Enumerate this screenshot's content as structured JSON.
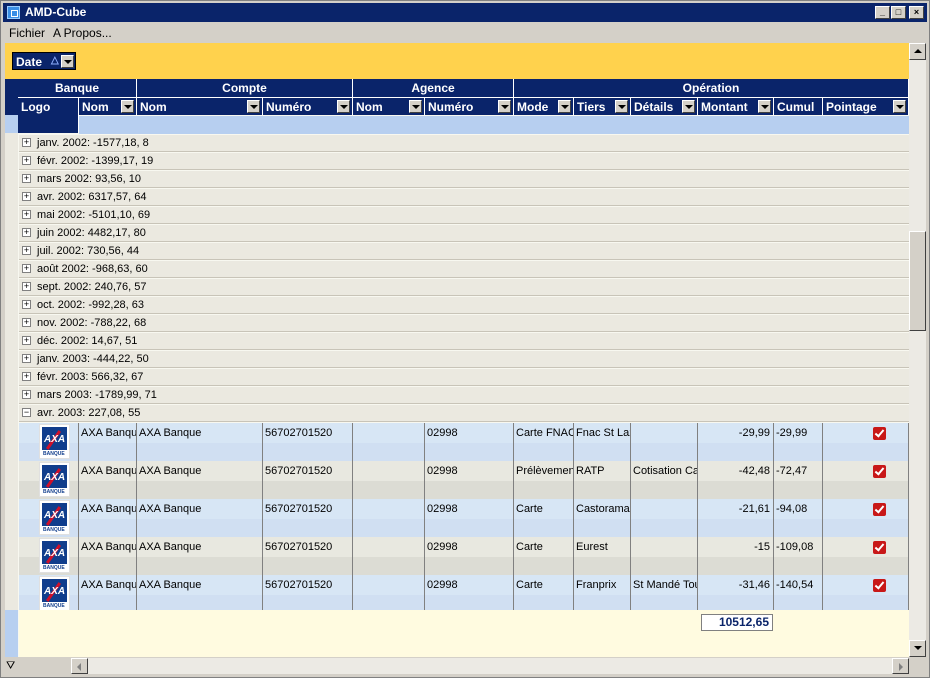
{
  "window": {
    "title": "AMD-Cube"
  },
  "menu": {
    "fichier": "Fichier",
    "apropos": "A Propos..."
  },
  "grouping": {
    "label": "Date"
  },
  "columns": {
    "banque": "Banque",
    "compte": "Compte",
    "agence": "Agence",
    "operation": "Opération",
    "logo": "Logo",
    "banque_nom": "Nom",
    "compte_nom": "Nom",
    "compte_numero": "Numéro",
    "agence_nom": "Nom",
    "agence_numero": "Numéro",
    "mode": "Mode",
    "tiers": "Tiers",
    "details": "Détails",
    "montant": "Montant",
    "cumul": "Cumul",
    "pointage": "Pointage"
  },
  "groups": [
    {
      "label": "janv. 2002: -1577,18, 8"
    },
    {
      "label": "févr. 2002: -1399,17, 19"
    },
    {
      "label": "mars 2002:  93,56, 10"
    },
    {
      "label": "avr. 2002:  6317,57, 64"
    },
    {
      "label": "mai 2002: -5101,10, 69"
    },
    {
      "label": "juin 2002:  4482,17, 80"
    },
    {
      "label": "juil. 2002:  730,56, 44"
    },
    {
      "label": "août 2002: -968,63, 60"
    },
    {
      "label": "sept. 2002:  240,76, 57"
    },
    {
      "label": "oct. 2002: -992,28, 63"
    },
    {
      "label": "nov. 2002: -788,22, 68"
    },
    {
      "label": "déc. 2002:  14,67, 51"
    },
    {
      "label": "janv. 2003: -444,22, 50"
    },
    {
      "label": "févr. 2003:  566,32, 67"
    },
    {
      "label": "mars 2003: -1789,99, 71"
    },
    {
      "label": "avr. 2003:  227,08, 55"
    }
  ],
  "records": [
    {
      "banque": "AXA Banque",
      "compte": "AXA Banque",
      "numero": "56702701520",
      "agence_nom": "",
      "agence_numero": "02998",
      "mode": "Carte FNAC",
      "tiers": "Fnac St Lazare",
      "details": "",
      "montant": "-29,99",
      "cumul": "-29,99",
      "logo_text": "AXA",
      "logo_sub": "BANQUE"
    },
    {
      "banque": "AXA Banque",
      "compte": "AXA Banque",
      "numero": "56702701520",
      "agence_nom": "",
      "agence_numero": "02998",
      "mode": "Prélèvement",
      "tiers": "RATP",
      "details": "Cotisation Carte",
      "montant": "-42,48",
      "cumul": "-72,47",
      "logo_text": "AXA",
      "logo_sub": "BANQUE"
    },
    {
      "banque": "AXA Banque",
      "compte": "AXA Banque",
      "numero": "56702701520",
      "agence_nom": "",
      "agence_numero": "02998",
      "mode": "Carte",
      "tiers": "Castorama",
      "details": "",
      "montant": "-21,61",
      "cumul": "-94,08",
      "logo_text": "AXA",
      "logo_sub": "BANQUE"
    },
    {
      "banque": "AXA Banque",
      "compte": "AXA Banque",
      "numero": "56702701520",
      "agence_nom": "",
      "agence_numero": "02998",
      "mode": "Carte",
      "tiers": "Eurest",
      "details": "",
      "montant": "-15",
      "cumul": "-109,08",
      "logo_text": "AXA",
      "logo_sub": "BANQUE"
    },
    {
      "banque": "AXA Banque",
      "compte": "AXA Banque",
      "numero": "56702701520",
      "agence_nom": "",
      "agence_numero": "02998",
      "mode": "Carte",
      "tiers": "Franprix",
      "details": "St Mandé Tourelle",
      "montant": "-31,46",
      "cumul": "-140,54",
      "logo_text": "AXA",
      "logo_sub": "BANQUE"
    }
  ],
  "footer": {
    "total": "10512,65"
  }
}
